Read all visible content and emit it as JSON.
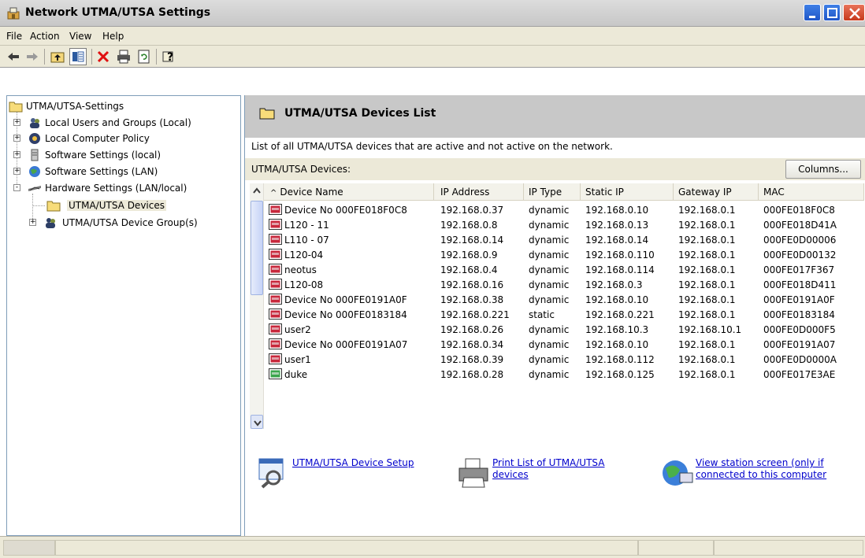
{
  "window": {
    "title": "Network UTMA/UTSA Settings",
    "min_label": "minimize",
    "max_label": "maximize",
    "close_label": "close"
  },
  "menu": {
    "file": "File",
    "action": "Action",
    "view": "View",
    "help": "Help"
  },
  "toolbar": {
    "icons": [
      "back-arrow-icon",
      "forward-arrow-icon",
      "up-folder-icon",
      "show-hide-tree-icon",
      "delete-icon",
      "print-icon",
      "refresh-icon",
      "help-icon"
    ],
    "delete_color": "#e01010"
  },
  "tree": {
    "root": "UTMA/UTSA-Settings",
    "items": [
      {
        "label": "Local Users and Groups (Local)",
        "icon": "users-icon",
        "expander": "+"
      },
      {
        "label": "Local Computer Policy",
        "icon": "policy-icon",
        "expander": "+"
      },
      {
        "label": "Software Settings (local)",
        "icon": "server-icon",
        "expander": "+"
      },
      {
        "label": "Software Settings (LAN)",
        "icon": "globe-icon",
        "expander": "+"
      },
      {
        "label": "Hardware Settings (LAN/local)",
        "icon": "hardware-icon",
        "expander": "-"
      }
    ],
    "children": [
      {
        "label": "UTMA/UTSA Devices",
        "icon": "folder-icon",
        "selected": true
      },
      {
        "label": "UTMA/UTSA Device Group(s)",
        "icon": "device-group-icon",
        "expander": "+"
      }
    ]
  },
  "main": {
    "header_title": "UTMA/UTSA Devices List",
    "description": "List of all UTMA/UTSA devices that are active and not active on the network.",
    "devices_label": "UTMA/UTSA Devices:",
    "columns_button": "Columns...",
    "sort_indicator": "^",
    "columns": [
      "Device Name",
      "IP Address",
      "IP Type",
      "Static IP",
      "Gateway IP",
      "MAC"
    ],
    "rows": [
      {
        "name": "Device No  000FE018F0C8",
        "ip": "192.168.0.37",
        "type": "dynamic",
        "static": "192.168.0.10",
        "gateway": "192.168.0.1",
        "mac": "000FE018F0C8",
        "status": "inactive"
      },
      {
        "name": "L120 - 11",
        "ip": "192.168.0.8",
        "type": "dynamic",
        "static": "192.168.0.13",
        "gateway": "192.168.0.1",
        "mac": "000FE018D41A",
        "status": "inactive"
      },
      {
        "name": "L110 - 07",
        "ip": "192.168.0.14",
        "type": "dynamic",
        "static": "192.168.0.14",
        "gateway": "192.168.0.1",
        "mac": "000FE0D00006",
        "status": "inactive"
      },
      {
        "name": "L120-04",
        "ip": "192.168.0.9",
        "type": "dynamic",
        "static": "192.168.0.110",
        "gateway": "192.168.0.1",
        "mac": "000FE0D00132",
        "status": "inactive"
      },
      {
        "name": "neotus",
        "ip": "192.168.0.4",
        "type": "dynamic",
        "static": "192.168.0.114",
        "gateway": "192.168.0.1",
        "mac": "000FE017F367",
        "status": "inactive"
      },
      {
        "name": "L120-08",
        "ip": "192.168.0.16",
        "type": "dynamic",
        "static": "192.168.0.3",
        "gateway": "192.168.0.1",
        "mac": "000FE018D411",
        "status": "inactive"
      },
      {
        "name": "Device No  000FE0191A0F",
        "ip": "192.168.0.38",
        "type": "dynamic",
        "static": "192.168.0.10",
        "gateway": "192.168.0.1",
        "mac": "000FE0191A0F",
        "status": "inactive"
      },
      {
        "name": "Device No  000FE0183184",
        "ip": "192.168.0.221",
        "type": "static",
        "static": "192.168.0.221",
        "gateway": "192.168.0.1",
        "mac": "000FE0183184",
        "status": "inactive"
      },
      {
        "name": "user2",
        "ip": "192.168.0.26",
        "type": "dynamic",
        "static": "192.168.10.3",
        "gateway": "192.168.10.1",
        "mac": "000FE0D000F5",
        "status": "inactive"
      },
      {
        "name": "Device No  000FE0191A07",
        "ip": "192.168.0.34",
        "type": "dynamic",
        "static": "192.168.0.10",
        "gateway": "192.168.0.1",
        "mac": "000FE0191A07",
        "status": "inactive"
      },
      {
        "name": "user1",
        "ip": "192.168.0.39",
        "type": "dynamic",
        "static": "192.168.0.112",
        "gateway": "192.168.0.1",
        "mac": "000FE0D0000A",
        "status": "inactive"
      },
      {
        "name": "duke",
        "ip": "192.168.0.28",
        "type": "dynamic",
        "static": "192.168.0.125",
        "gateway": "192.168.0.1",
        "mac": "000FE017E3AE",
        "status": "active"
      }
    ],
    "status_colors": {
      "inactive": "#c8283c",
      "active": "#3aa64c"
    }
  },
  "links": {
    "setup": "UTMA/UTSA Device Setup",
    "print": "Print List of UTMA/UTSA devices",
    "station": "View station screen (only if connected to this computer"
  }
}
